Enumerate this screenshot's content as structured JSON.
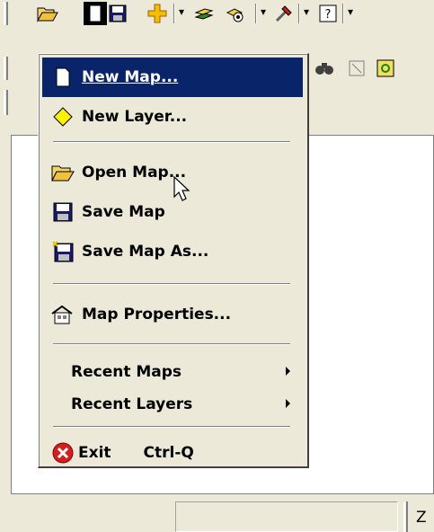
{
  "menu": {
    "items": [
      {
        "label": "New Map...",
        "icon": "new-document-icon",
        "highlighted": true
      },
      {
        "label": "New Layer...",
        "icon": "new-layer-diamond-icon"
      },
      {
        "label": "Open Map...",
        "icon": "open-folder-icon"
      },
      {
        "label": "Save Map",
        "icon": "floppy-disk-icon"
      },
      {
        "label": "Save Map As...",
        "icon": "save-as-floppy-icon"
      },
      {
        "label": "Map Properties...",
        "icon": "properties-icon"
      },
      {
        "label": "Recent Maps",
        "submenu": true
      },
      {
        "label": "Recent Layers",
        "submenu": true
      },
      {
        "label": "Exit",
        "icon": "exit-x-icon",
        "shortcut": "Ctrl-Q"
      }
    ]
  },
  "status_bar": {
    "right_text": "Z"
  },
  "colors": {
    "highlight": "#0a246a",
    "chrome": "#ece9d8"
  }
}
